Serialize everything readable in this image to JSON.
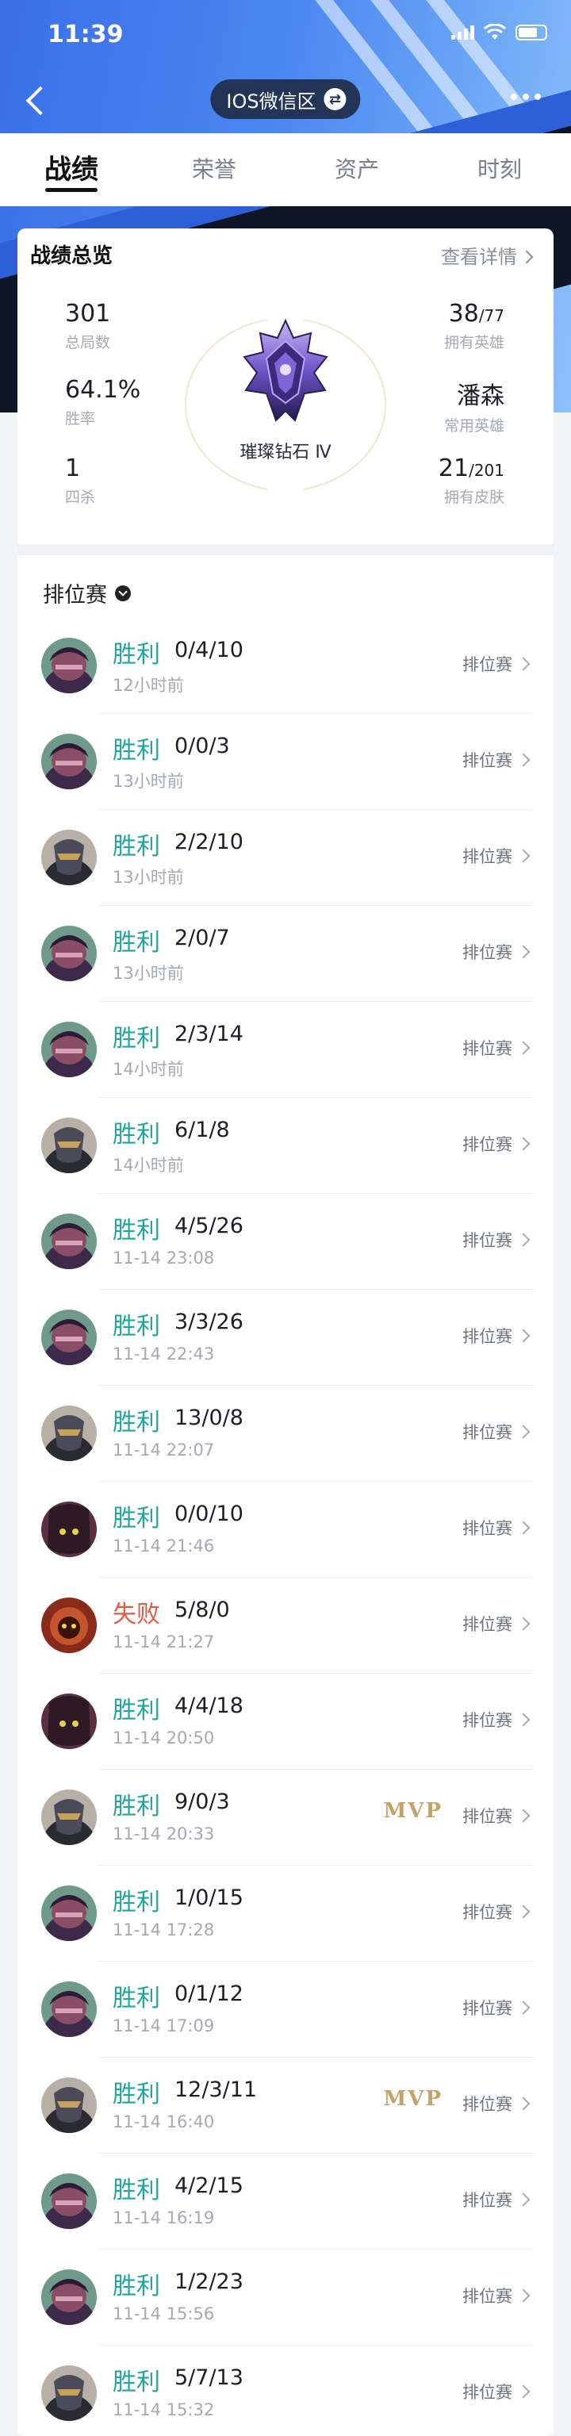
{
  "status": {
    "time": "11:39"
  },
  "nav": {
    "server": "IOS微信区"
  },
  "tabs": [
    "战绩",
    "荣誉",
    "资产",
    "时刻"
  ],
  "overview": {
    "title": "战绩总览",
    "detail": "查看详情",
    "total_games": {
      "value": "301",
      "label": "总局数"
    },
    "win_rate": {
      "value": "64.1%",
      "label": "胜率"
    },
    "quadra": {
      "value": "1",
      "label": "四杀"
    },
    "heroes": {
      "value": "38",
      "total": "/77",
      "label": "拥有英雄"
    },
    "common_hero": {
      "value": "潘森",
      "label": "常用英雄"
    },
    "skins": {
      "value": "21",
      "total": "/201",
      "label": "拥有皮肤"
    },
    "rank": "璀璨钻石 Ⅳ"
  },
  "section": {
    "title": "排位赛"
  },
  "matches": [
    {
      "result": "胜利",
      "win": true,
      "kda": "0/4/10",
      "time": "12小时前",
      "mode": "排位赛",
      "mvp": "",
      "avatar": "a"
    },
    {
      "result": "胜利",
      "win": true,
      "kda": "0/0/3",
      "time": "13小时前",
      "mode": "排位赛",
      "mvp": "",
      "avatar": "a"
    },
    {
      "result": "胜利",
      "win": true,
      "kda": "2/2/10",
      "time": "13小时前",
      "mode": "排位赛",
      "mvp": "",
      "avatar": "b"
    },
    {
      "result": "胜利",
      "win": true,
      "kda": "2/0/7",
      "time": "13小时前",
      "mode": "排位赛",
      "mvp": "",
      "avatar": "a"
    },
    {
      "result": "胜利",
      "win": true,
      "kda": "2/3/14",
      "time": "14小时前",
      "mode": "排位赛",
      "mvp": "",
      "avatar": "a"
    },
    {
      "result": "胜利",
      "win": true,
      "kda": "6/1/8",
      "time": "14小时前",
      "mode": "排位赛",
      "mvp": "",
      "avatar": "b"
    },
    {
      "result": "胜利",
      "win": true,
      "kda": "4/5/26",
      "time": "11-14 23:08",
      "mode": "排位赛",
      "mvp": "",
      "avatar": "a"
    },
    {
      "result": "胜利",
      "win": true,
      "kda": "3/3/26",
      "time": "11-14 22:43",
      "mode": "排位赛",
      "mvp": "",
      "avatar": "a"
    },
    {
      "result": "胜利",
      "win": true,
      "kda": "13/0/8",
      "time": "11-14 22:07",
      "mode": "排位赛",
      "mvp": "",
      "avatar": "b"
    },
    {
      "result": "胜利",
      "win": true,
      "kda": "0/0/10",
      "time": "11-14 21:46",
      "mode": "排位赛",
      "mvp": "",
      "avatar": "c"
    },
    {
      "result": "失败",
      "win": false,
      "kda": "5/8/0",
      "time": "11-14 21:27",
      "mode": "排位赛",
      "mvp": "",
      "avatar": "d"
    },
    {
      "result": "胜利",
      "win": true,
      "kda": "4/4/18",
      "time": "11-14 20:50",
      "mode": "排位赛",
      "mvp": "",
      "avatar": "c"
    },
    {
      "result": "胜利",
      "win": true,
      "kda": "9/0/3",
      "time": "11-14 20:33",
      "mode": "排位赛",
      "mvp": "MVP",
      "avatar": "b"
    },
    {
      "result": "胜利",
      "win": true,
      "kda": "1/0/15",
      "time": "11-14 17:28",
      "mode": "排位赛",
      "mvp": "",
      "avatar": "a"
    },
    {
      "result": "胜利",
      "win": true,
      "kda": "0/1/12",
      "time": "11-14 17:09",
      "mode": "排位赛",
      "mvp": "",
      "avatar": "a"
    },
    {
      "result": "胜利",
      "win": true,
      "kda": "12/3/11",
      "time": "11-14 16:40",
      "mode": "排位赛",
      "mvp": "MVP",
      "avatar": "b"
    },
    {
      "result": "胜利",
      "win": true,
      "kda": "4/2/15",
      "time": "11-14 16:19",
      "mode": "排位赛",
      "mvp": "",
      "avatar": "a"
    },
    {
      "result": "胜利",
      "win": true,
      "kda": "1/2/23",
      "time": "11-14 15:56",
      "mode": "排位赛",
      "mvp": "",
      "avatar": "a"
    },
    {
      "result": "胜利",
      "win": true,
      "kda": "5/7/13",
      "time": "11-14 15:32",
      "mode": "排位赛",
      "mvp": "",
      "avatar": "b"
    }
  ]
}
